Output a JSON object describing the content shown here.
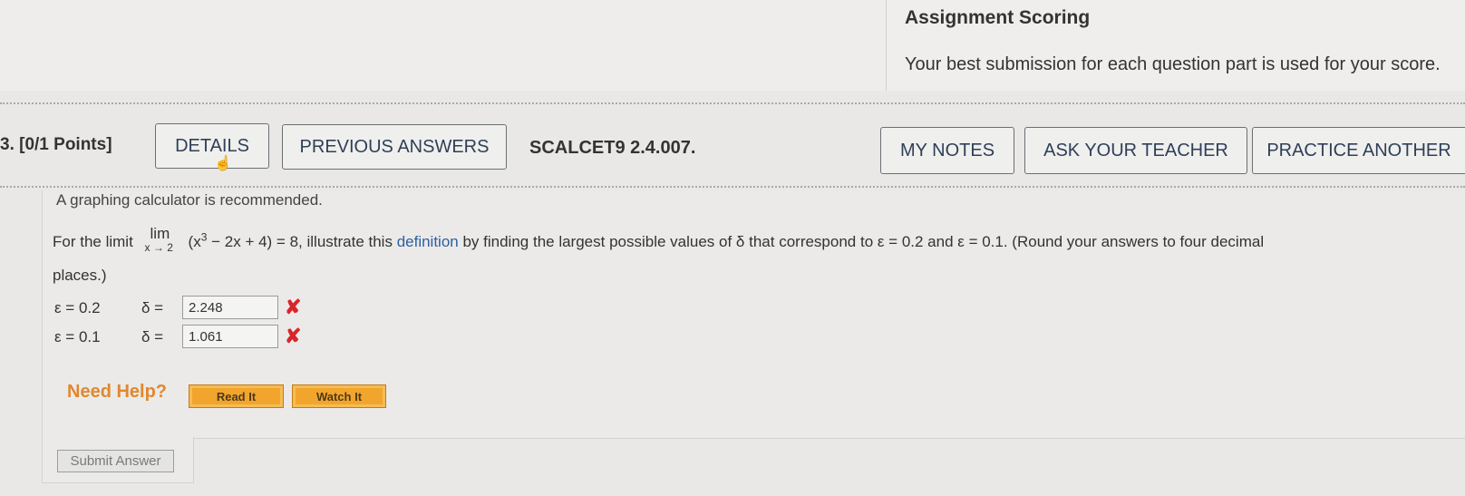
{
  "scoring": {
    "title": "Assignment Scoring",
    "text": "Your best submission for each question part is used for your score."
  },
  "question": {
    "number": "3. [0/1 Points]",
    "code": "SCALCET9 2.4.007."
  },
  "toolbar": {
    "details_label": "DETAILS",
    "previous_answers_label": "PREVIOUS ANSWERS",
    "my_notes_label": "MY NOTES",
    "ask_teacher_label": "ASK YOUR TEACHER",
    "practice_label": "PRACTICE ANOTHER"
  },
  "content": {
    "calculator_note": "A graphing calculator is recommended.",
    "problem_prefix": "For the limit",
    "lim_word": "lim",
    "lim_sub": "x → 2",
    "lim_expr_a": "(x",
    "lim_expr_exp": "3",
    "lim_expr_b": " − 2x + 4) = 8, illustrate this ",
    "definition_link": "definition",
    "problem_suffix": " by finding the largest possible values of δ that correspond to ε = 0.2 and ε = 0.1. (Round your answers to four decimal",
    "problem_line2": "places.)"
  },
  "answers": [
    {
      "epsilon": "ε = 0.2",
      "delta_label": "δ =",
      "value": "2.248",
      "status": "incorrect"
    },
    {
      "epsilon": "ε = 0.1",
      "delta_label": "δ =",
      "value": "1.061",
      "status": "incorrect"
    }
  ],
  "help": {
    "label": "Need Help?",
    "read_label": "Read It",
    "watch_label": "Watch It"
  },
  "submit_label": "Submit Answer",
  "icons": {
    "incorrect": "close-icon",
    "incorrect_glyph": "✘",
    "cursor": "hand-cursor-icon",
    "cursor_glyph": "☝"
  },
  "colors": {
    "error": "#d8262c",
    "help_orange": "#e0882e",
    "button_orange": "#f2a52c",
    "link_blue": "#2d5f9f"
  }
}
